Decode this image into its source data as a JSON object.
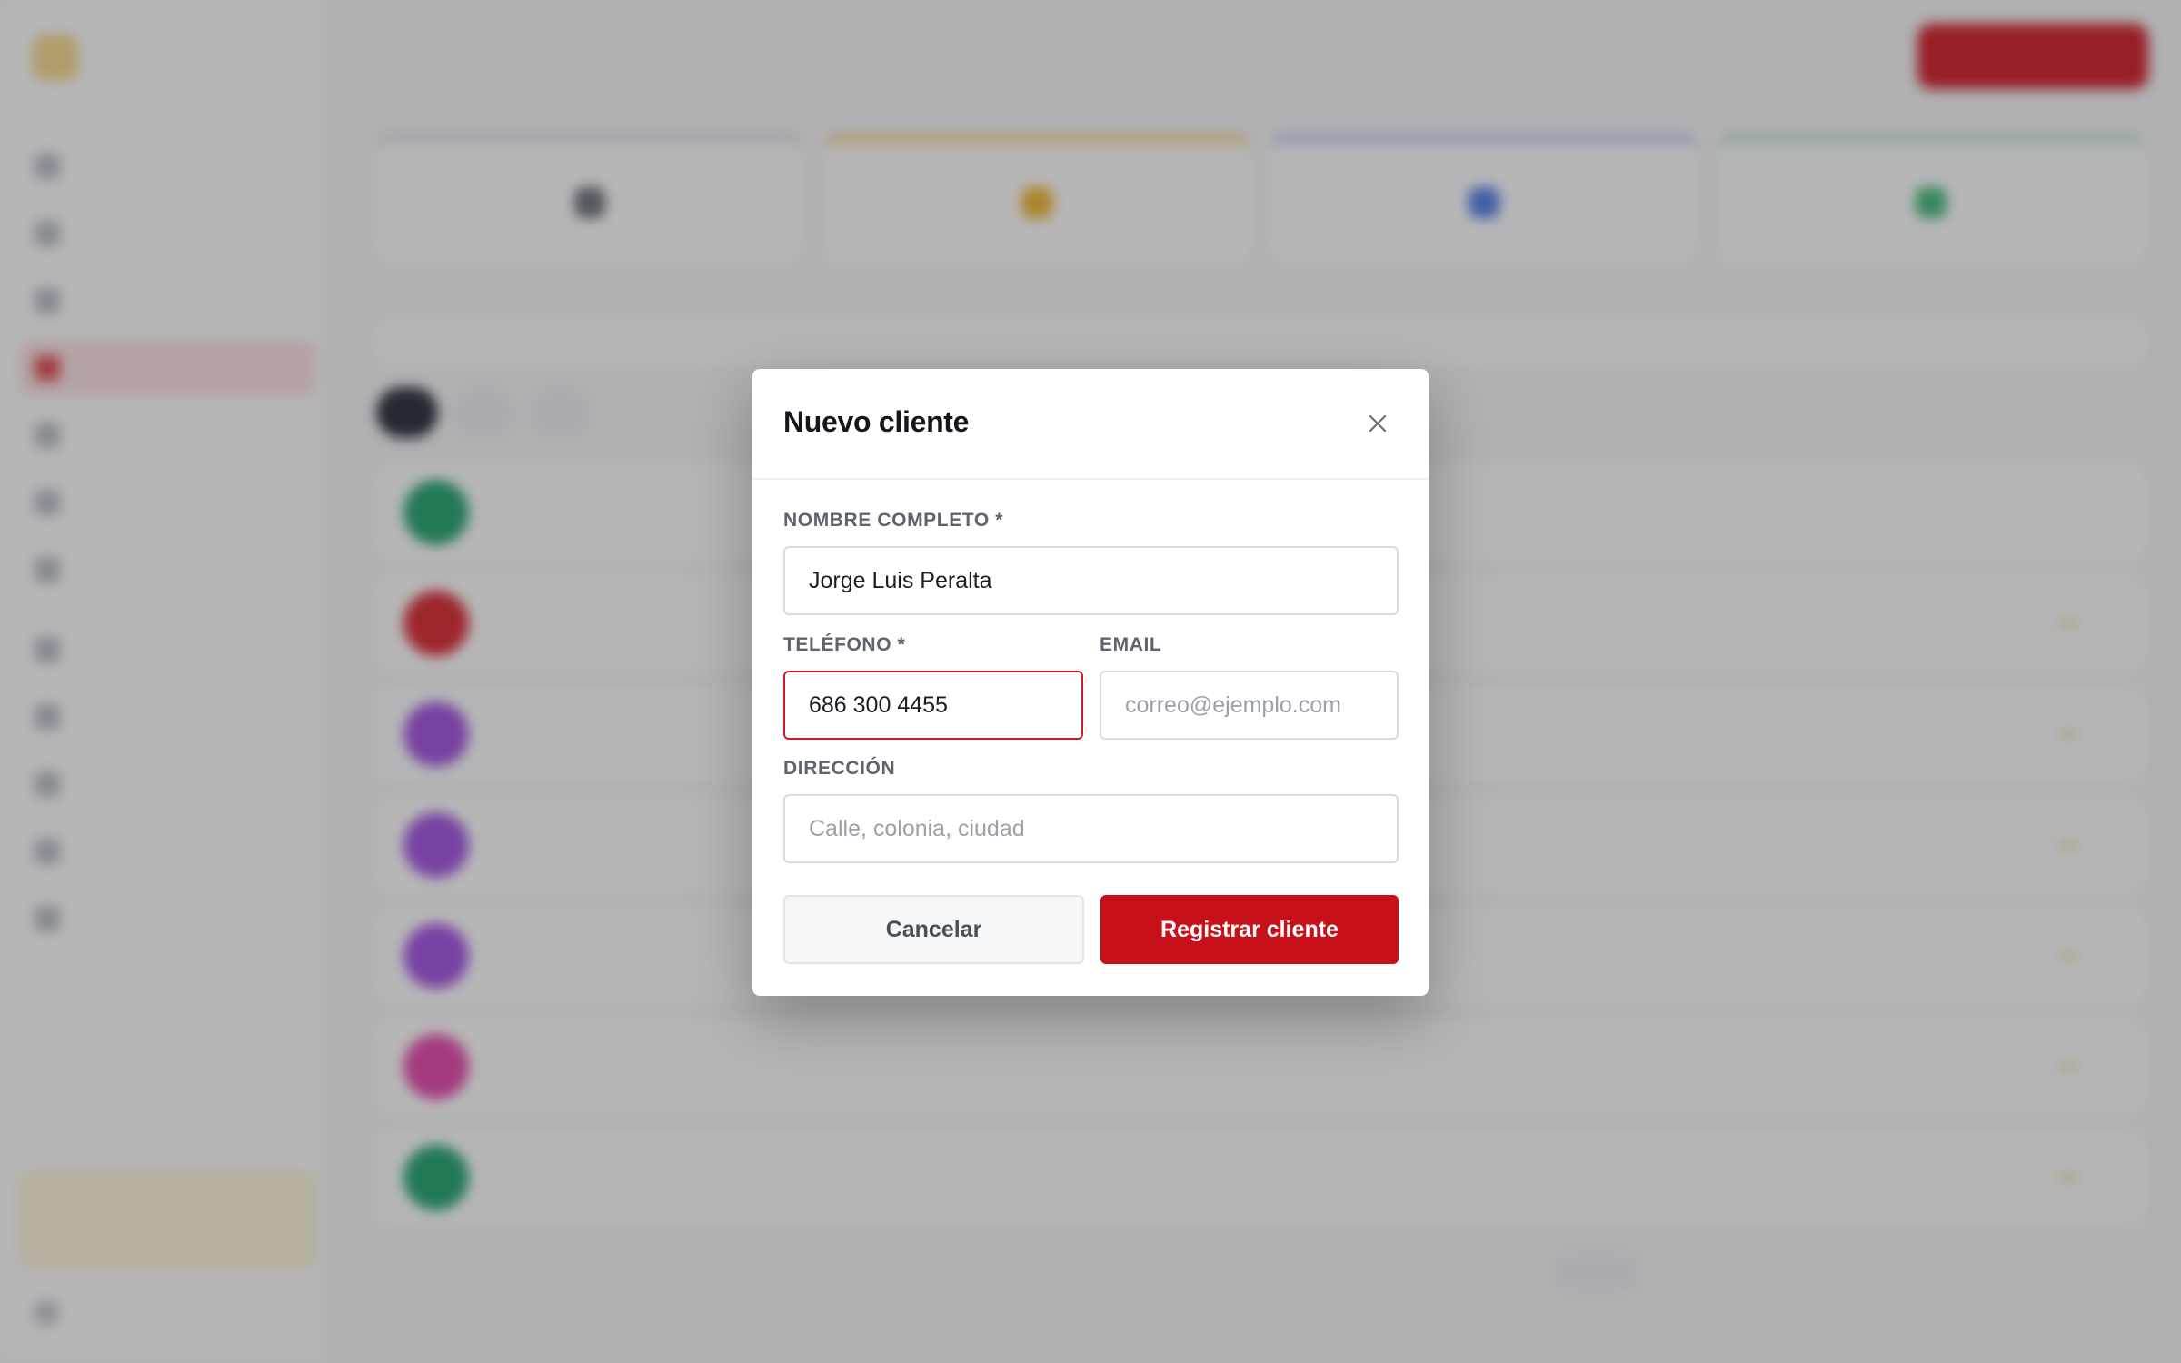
{
  "modal": {
    "title": "Nuevo cliente",
    "name_label": "NOMBRE COMPLETO *",
    "name_value": "Jorge Luis Peralta",
    "phone_label": "TELÉFONO *",
    "phone_value": "686 300 4455",
    "email_label": "EMAIL",
    "email_placeholder": "correo@ejemplo.com",
    "address_label": "DIRECCIÓN",
    "address_placeholder": "Calle, colonia, ciudad",
    "cancel_label": "Cancelar",
    "submit_label": "Registrar cliente",
    "close_icon": "close-icon"
  },
  "colors": {
    "accent": "#c8101b",
    "error_border": "#d11a25",
    "overlay": "rgba(40,40,44,0.34)"
  }
}
